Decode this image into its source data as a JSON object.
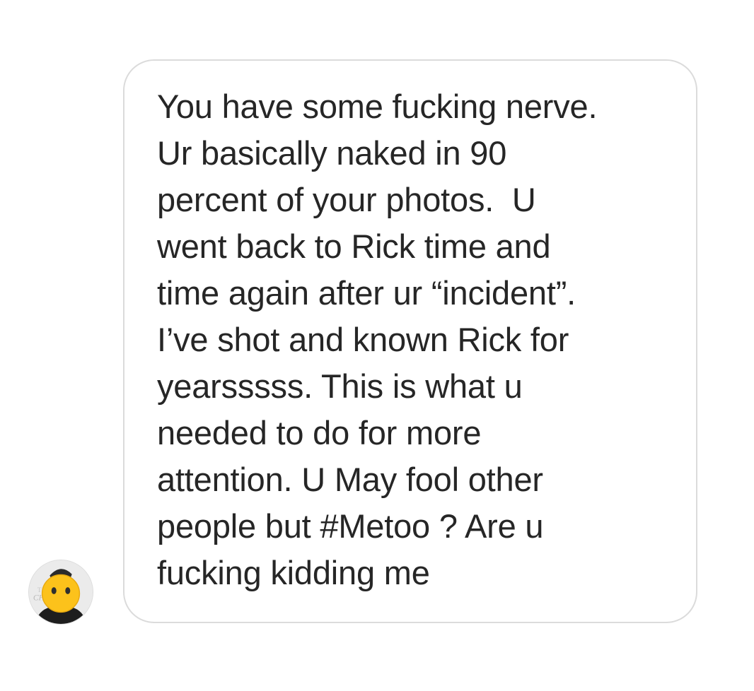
{
  "conversation": {
    "incoming_message": {
      "lines": [
        "You have some fucking nerve.",
        "Ur basically naked in 90",
        "percent of your photos.  U",
        "went back to Rick time and",
        "time again after ur “incident”.",
        "I’ve shot and known Rick for",
        "yearsssss. This is what u",
        "needed to do for more",
        "attention. U May fool other",
        "people but #Metoo ? Are u",
        "fucking kidding me"
      ]
    },
    "sender": {
      "avatar_icon": "profile-photo-with-face-emoji",
      "face_emoji": "😶"
    }
  },
  "colors": {
    "text": "#262626",
    "bubble_border": "#dbdbdb",
    "background": "#ffffff",
    "emoji_face": "#fcc21b"
  }
}
